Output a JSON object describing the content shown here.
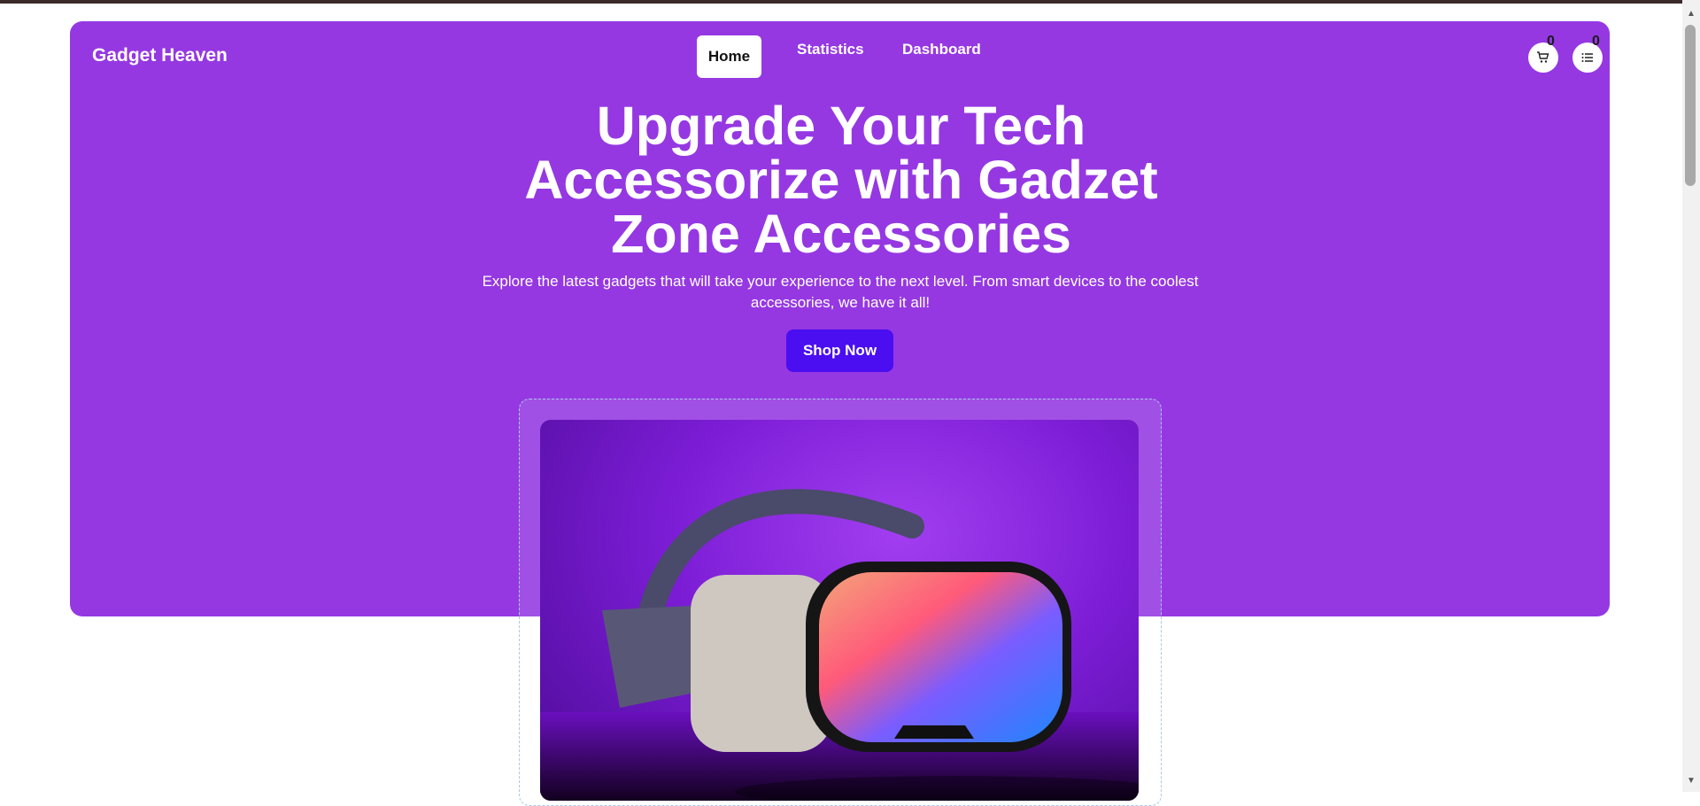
{
  "brand": {
    "name": "Gadget Heaven"
  },
  "nav": {
    "items": [
      {
        "label": "Home",
        "active": true
      },
      {
        "label": "Statistics",
        "active": false
      },
      {
        "label": "Dashboard",
        "active": false
      }
    ]
  },
  "header_icons": {
    "cart": {
      "icon": "shopping-cart-icon",
      "count": "0"
    },
    "wishlist": {
      "icon": "list-icon",
      "count": "0"
    }
  },
  "hero": {
    "headline_lines": [
      "Upgrade Your Tech",
      "Accessorize with Gadzet",
      "Zone Accessories"
    ],
    "subtext": "Explore the latest gadgets that will take your experience to the next level. From smart devices to the coolest accessories, we have it all!",
    "cta_label": "Shop Now",
    "image": "vr-headset-image"
  },
  "colors": {
    "hero_bg": "#9538e2",
    "cta_bg": "#4a0ef0",
    "nav_active_bg": "#ffffff"
  }
}
